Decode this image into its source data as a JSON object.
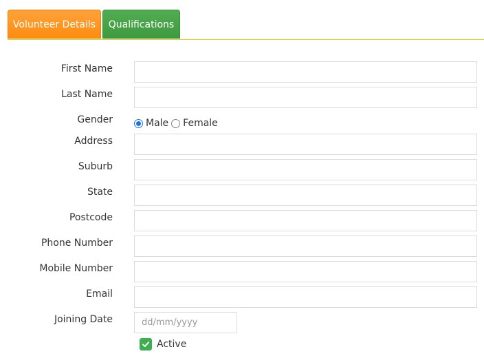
{
  "tabs": [
    {
      "label": "Volunteer Details",
      "active": true
    },
    {
      "label": "Qualifications",
      "active": false
    }
  ],
  "form": {
    "first_name": {
      "label": "First Name",
      "value": ""
    },
    "last_name": {
      "label": "Last Name",
      "value": ""
    },
    "gender": {
      "label": "Gender",
      "options": [
        "Male",
        "Female"
      ],
      "selected": "Male"
    },
    "address": {
      "label": "Address",
      "value": ""
    },
    "suburb": {
      "label": "Suburb",
      "value": ""
    },
    "state": {
      "label": "State",
      "value": ""
    },
    "postcode": {
      "label": "Postcode",
      "value": ""
    },
    "phone_number": {
      "label": "Phone Number",
      "value": ""
    },
    "mobile_number": {
      "label": "Mobile Number",
      "value": ""
    },
    "email": {
      "label": "Email",
      "value": ""
    },
    "joining_date": {
      "label": "Joining Date",
      "placeholder": "dd/mm/yyyy",
      "value": ""
    },
    "active": {
      "label": "Active",
      "checked": true
    }
  },
  "colors": {
    "tab_volunteer": "#ff9a2a",
    "tab_qualifications": "#46a346",
    "checkbox_checked": "#3cb050",
    "radio_selected": "#1a73e8"
  }
}
